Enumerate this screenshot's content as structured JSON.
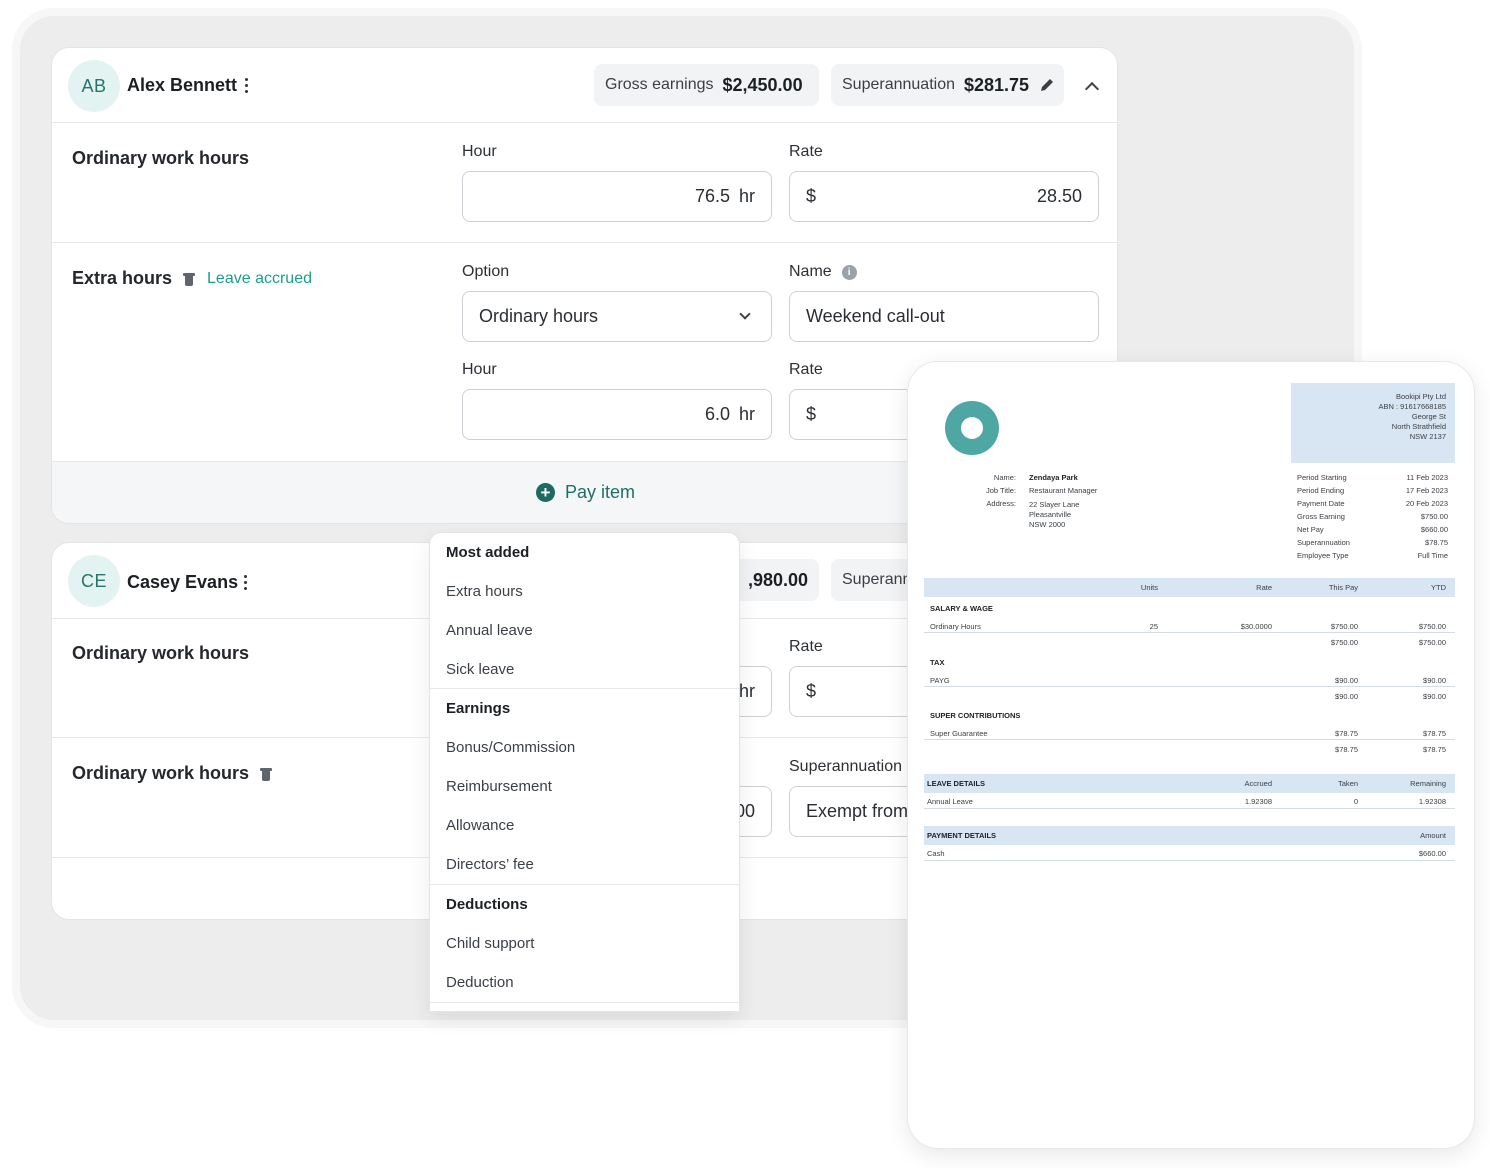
{
  "employees": [
    {
      "initials": "AB",
      "name": "Alex Bennett",
      "gross_label": "Gross earnings",
      "gross_value": "$2,450.00",
      "super_label": "Superannuation",
      "super_value": "$281.75",
      "sections": {
        "ordinary": {
          "title": "Ordinary work hours",
          "hour_label": "Hour",
          "hour_value": "76.5",
          "hour_unit": "hr",
          "rate_label": "Rate",
          "rate_currency": "$",
          "rate_value": "28.50"
        },
        "extra": {
          "title": "Extra hours",
          "tag": "Leave accrued",
          "option_label": "Option",
          "option_value": "Ordinary hours",
          "name_label": "Name",
          "name_value": "Weekend call-out",
          "hour_label": "Hour",
          "hour_value": "6.0",
          "hour_unit": "hr",
          "rate_label": "Rate",
          "rate_currency": "$"
        }
      },
      "pay_item_label": "Pay item"
    },
    {
      "initials": "CE",
      "name": "Casey Evans",
      "gross_value_partial": ",980.00",
      "super_label_partial": "Superann",
      "sections": {
        "ordinary": {
          "title": "Ordinary work hours",
          "hour_unit_partial": "hr",
          "rate_label": "Rate",
          "rate_currency": "$"
        },
        "ordinary2": {
          "title": "Ordinary work hours",
          "value_partial": "00",
          "super_label": "Superannuation",
          "super_value_partial": "Exempt from"
        }
      }
    }
  ],
  "menu": {
    "groups": [
      {
        "heading": "Most added",
        "items": [
          "Extra hours",
          "Annual leave",
          "Sick leave"
        ]
      },
      {
        "heading": "Earnings",
        "items": [
          "Bonus/Commission",
          "Reimbursement",
          "Allowance",
          "Directors’ fee"
        ]
      },
      {
        "heading": "Deductions",
        "items": [
          "Child support",
          "Deduction"
        ]
      }
    ]
  },
  "payslip": {
    "company": [
      "Bookipi Pty Ltd",
      "ABN : 91617668185",
      "George St",
      "North Strathfield",
      "NSW 2137"
    ],
    "employee_labels": [
      "Name:",
      "Job Title:",
      "Address:"
    ],
    "employee_name": "Zendaya Park",
    "job_title": "Restaurant Manager",
    "address": [
      "22 Slayer Lane",
      "Pleasantville",
      "NSW 2000"
    ],
    "summary": [
      {
        "label": "Period Starting",
        "value": "11 Feb 2023"
      },
      {
        "label": "Period Ending",
        "value": "17 Feb 2023"
      },
      {
        "label": "Payment Date",
        "value": "20 Feb 2023"
      },
      {
        "label": "Gross Earning",
        "value": "$750.00"
      },
      {
        "label": "Net Pay",
        "value": "$660.00"
      },
      {
        "label": "Superannuation",
        "value": "$78.75"
      },
      {
        "label": "Employee Type",
        "value": "Full Time"
      }
    ],
    "table_headers": [
      "Units",
      "Rate",
      "This Pay",
      "YTD"
    ],
    "salary_heading": "SALARY & WAGE",
    "salary_row": {
      "label": "Ordinary Hours",
      "units": "25",
      "rate": "$30.0000",
      "this_pay": "$750.00",
      "ytd": "$750.00"
    },
    "salary_total": {
      "this_pay": "$750.00",
      "ytd": "$750.00"
    },
    "tax_heading": "TAX",
    "tax_row": {
      "label": "PAYG",
      "this_pay": "$90.00",
      "ytd": "$90.00"
    },
    "tax_total": {
      "this_pay": "$90.00",
      "ytd": "$90.00"
    },
    "super_heading": "SUPER CONTRIBUTIONS",
    "super_row": {
      "label": "Super Guarantee",
      "this_pay": "$78.75",
      "ytd": "$78.75"
    },
    "super_total": {
      "this_pay": "$78.75",
      "ytd": "$78.75"
    },
    "leave_heading": "LEAVE DETAILS",
    "leave_headers": [
      "Accrued",
      "Taken",
      "Remaining"
    ],
    "leave_row": {
      "label": "Annual Leave",
      "accrued": "1.92308",
      "taken": "0",
      "remaining": "1.92308"
    },
    "payment_heading": "PAYMENT DETAILS",
    "payment_header": "Amount",
    "payment_row": {
      "label": "Cash",
      "amount": "$660.00"
    }
  },
  "colors": {
    "accent": "#1e9e8a",
    "avatar_bg": "#e3f3f1",
    "doc_band": "#d8e6f3",
    "logo": "#4fa7a3"
  }
}
